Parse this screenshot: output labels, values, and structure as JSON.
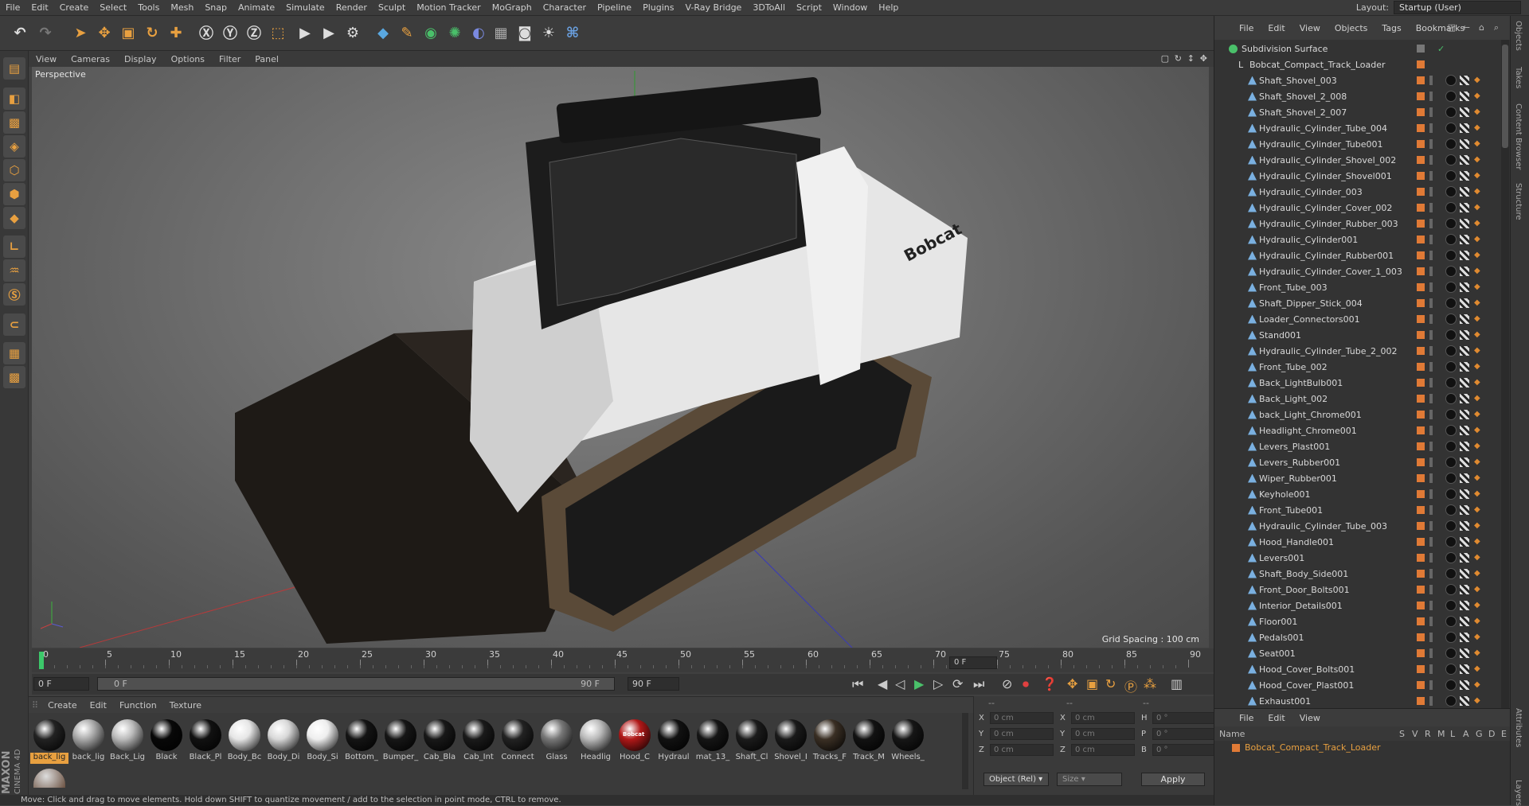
{
  "menu": [
    "File",
    "Edit",
    "Create",
    "Select",
    "Tools",
    "Mesh",
    "Snap",
    "Animate",
    "Simulate",
    "Render",
    "Sculpt",
    "Motion Tracker",
    "MoGraph",
    "Character",
    "Pipeline",
    "Plugins",
    "V-Ray Bridge",
    "3DToAll",
    "Script",
    "Window",
    "Help"
  ],
  "layout": {
    "label": "Layout:",
    "value": "Startup (User)"
  },
  "viewport": {
    "menu": [
      "View",
      "Cameras",
      "Display",
      "Options",
      "Filter",
      "Panel"
    ],
    "camera": "Perspective",
    "grid_spacing": "Grid Spacing : 100 cm",
    "model_logo": "Bobcat"
  },
  "timeline": {
    "ticks": [
      "0",
      "5",
      "10",
      "15",
      "20",
      "25",
      "30",
      "35",
      "40",
      "45",
      "50",
      "55",
      "60",
      "65",
      "70",
      "75",
      "80",
      "85",
      "90"
    ],
    "current_frame_right": "0 F",
    "start": "0 F",
    "range_start": "0 F",
    "range_end": "90 F",
    "end": "90 F"
  },
  "materials": {
    "menu": [
      "Create",
      "Edit",
      "Function",
      "Texture"
    ],
    "items": [
      {
        "name": "back_lig",
        "color": "#222"
      },
      {
        "name": "back_lig",
        "color": "#aaa"
      },
      {
        "name": "Back_Lig",
        "color": "#bbb"
      },
      {
        "name": "Black",
        "color": "#080808"
      },
      {
        "name": "Black_Pl",
        "color": "#111"
      },
      {
        "name": "Body_Bc",
        "color": "#e6e6e6"
      },
      {
        "name": "Body_Di",
        "color": "#d8d8d8"
      },
      {
        "name": "Body_Si",
        "color": "#eeeeee"
      },
      {
        "name": "Bottom_",
        "color": "#141414"
      },
      {
        "name": "Bumper_",
        "color": "#161616"
      },
      {
        "name": "Cab_Bla",
        "color": "#181818"
      },
      {
        "name": "Cab_Int",
        "color": "#1a1a1a"
      },
      {
        "name": "Connect",
        "color": "#222"
      },
      {
        "name": "Glass",
        "color": "#777"
      },
      {
        "name": "Headlig",
        "color": "#bbb"
      },
      {
        "name": "Hood_C",
        "color": "#b01818"
      },
      {
        "name": "Hydraul",
        "color": "#111"
      },
      {
        "name": "mat_13_",
        "color": "#151515"
      },
      {
        "name": "Shaft_Cl",
        "color": "#1b1b1b"
      },
      {
        "name": "Shovel_I",
        "color": "#1a1a1a"
      },
      {
        "name": "Tracks_F",
        "color": "#3a2f24"
      },
      {
        "name": "Track_M",
        "color": "#121212"
      },
      {
        "name": "Wheels_",
        "color": "#161616"
      }
    ],
    "hood_logo": "Bobcat"
  },
  "coords": {
    "rows": [
      {
        "a": "X",
        "av": "0 cm",
        "b": "X",
        "bv": "0 cm",
        "c": "H",
        "cv": "0 °"
      },
      {
        "a": "Y",
        "av": "0 cm",
        "b": "Y",
        "bv": "0 cm",
        "c": "P",
        "cv": "0 °"
      },
      {
        "a": "Z",
        "av": "0 cm",
        "b": "Z",
        "bv": "0 cm",
        "c": "B",
        "cv": "0 °"
      }
    ],
    "mode": "Object (Rel)",
    "size": "Size",
    "apply": "Apply",
    "header_a": "--",
    "header_b": "--",
    "header_c": "--"
  },
  "status": "Move: Click and drag to move elements. Hold down SHIFT to quantize movement / add to the selection in point mode, CTRL to remove.",
  "objects": {
    "menu": [
      "File",
      "Edit",
      "View",
      "Objects",
      "Tags",
      "Bookmarks"
    ],
    "root": "Subdivision Surface",
    "group": "Bobcat_Compact_Track_Loader",
    "items": [
      "Shaft_Shovel_003",
      "Shaft_Shovel_2_008",
      "Shaft_Shovel_2_007",
      "Hydraulic_Cylinder_Tube_004",
      "Hydraulic_Cylinder_Tube001",
      "Hydraulic_Cylinder_Shovel_002",
      "Hydraulic_Cylinder_Shovel001",
      "Hydraulic_Cylinder_003",
      "Hydraulic_Cylinder_Cover_002",
      "Hydraulic_Cylinder_Rubber_003",
      "Hydraulic_Cylinder001",
      "Hydraulic_Cylinder_Rubber001",
      "Hydraulic_Cylinder_Cover_1_003",
      "Front_Tube_003",
      "Shaft_Dipper_Stick_004",
      "Loader_Connectors001",
      "Stand001",
      "Hydraulic_Cylinder_Tube_2_002",
      "Front_Tube_002",
      "Back_LightBulb001",
      "Back_Light_002",
      "back_Light_Chrome001",
      "Headlight_Chrome001",
      "Levers_Plast001",
      "Levers_Rubber001",
      "Wiper_Rubber001",
      "Keyhole001",
      "Front_Tube001",
      "Hydraulic_Cylinder_Tube_003",
      "Hood_Handle001",
      "Levers001",
      "Shaft_Body_Side001",
      "Front_Door_Bolts001",
      "Interior_Details001",
      "Floor001",
      "Pedals001",
      "Seat001",
      "Hood_Cover_Bolts001",
      "Hood_Cover_Plast001",
      "Exhaust001"
    ]
  },
  "attributes": {
    "menu": [
      "File",
      "Edit",
      "View"
    ],
    "columns": [
      "Name",
      "S",
      "V",
      "R",
      "M",
      "L",
      "A",
      "G",
      "D",
      "E"
    ],
    "row": "Bobcat_Compact_Track_Loader"
  },
  "side_tabs": [
    "Objects",
    "Takes",
    "Content Browser",
    "Structure",
    "Attributes",
    "Layers"
  ],
  "brand": {
    "line1": "MAXON",
    "line2": "CINEMA 4D"
  }
}
